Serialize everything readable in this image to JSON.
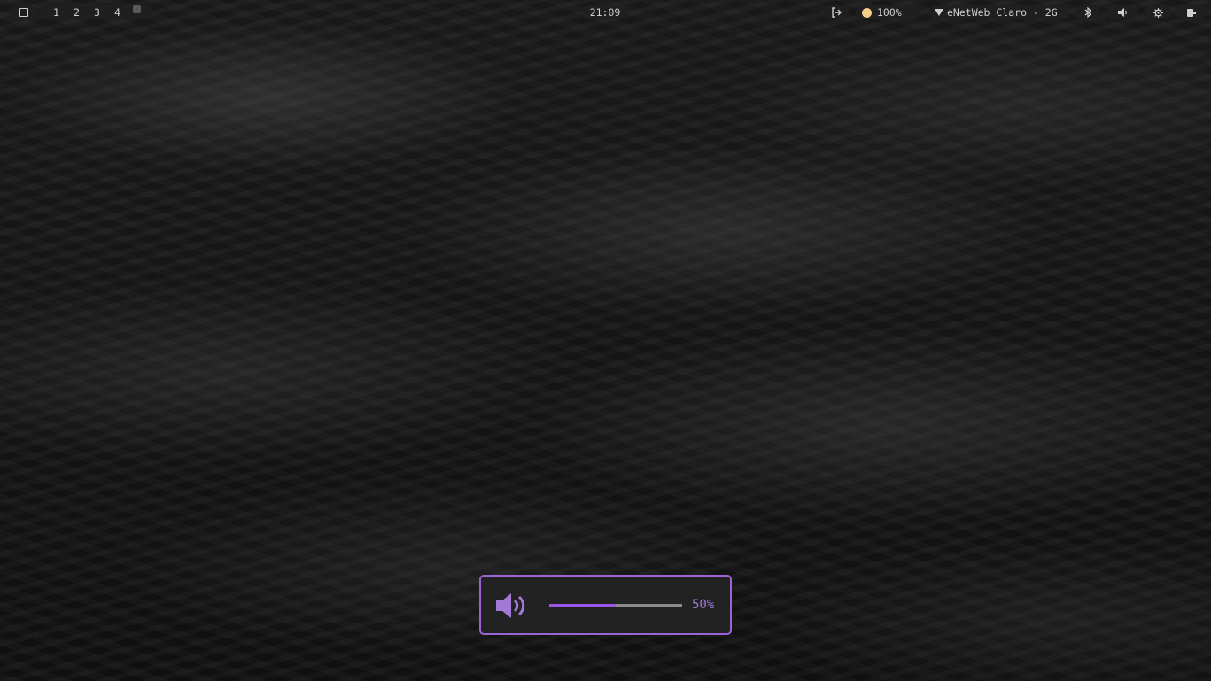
{
  "topbar": {
    "workspaces": [
      "1",
      "2",
      "3",
      "4"
    ],
    "clock": "21:09",
    "brightness": "100%",
    "network_name": "eNetWeb Claro - 2G"
  },
  "icons": {
    "layout": "layout-square-icon",
    "workspace_empty": "workspace-dot-icon",
    "logout": "logout-icon",
    "brightness": "sun-icon",
    "wifi": "wifi-icon",
    "bluetooth": "bluetooth-icon",
    "volume": "speaker-icon",
    "settings": "gear-icon",
    "power": "battery-icon"
  },
  "osd": {
    "volume_label": "50%",
    "volume_level": 0.5,
    "accent": "#9a55e6"
  },
  "colors": {
    "pill_bg": "#1f1f1f",
    "text": "#cfcfcf",
    "osd_border": "#9a63d6"
  }
}
